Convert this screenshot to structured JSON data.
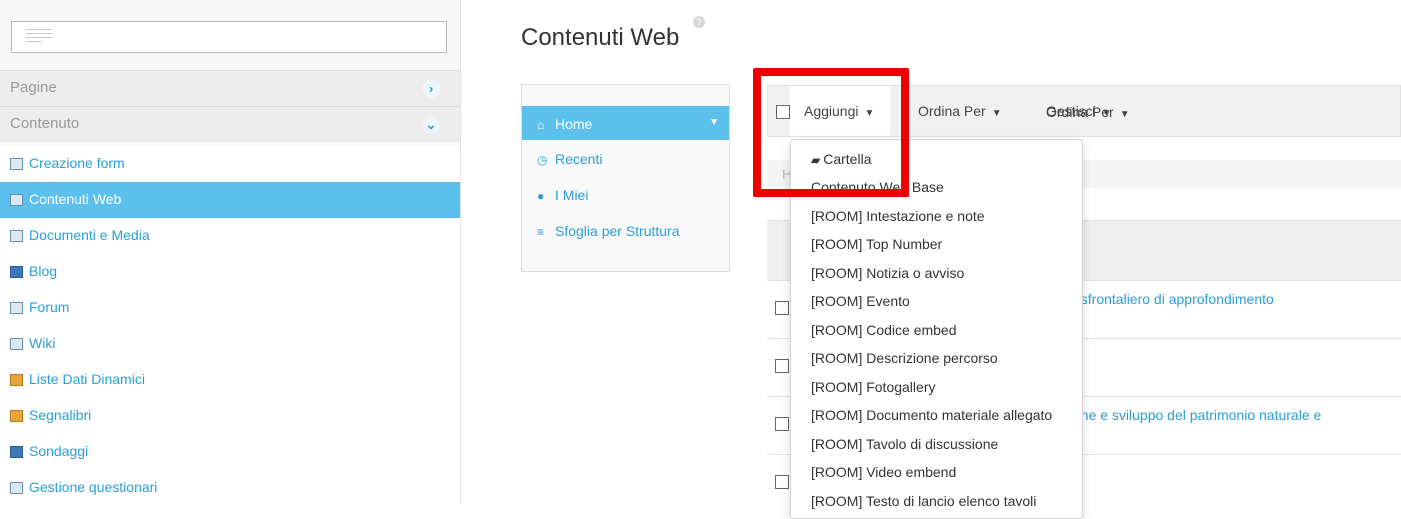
{
  "sidebar": {
    "panels": [
      {
        "label": "Pagine",
        "chevron": "›"
      },
      {
        "label": "Contenuto",
        "chevron": "⌄"
      }
    ],
    "items": [
      {
        "label": "Creazione form",
        "icon": "form-icon"
      },
      {
        "label": "Contenuti Web",
        "icon": "web-content-icon",
        "active": true
      },
      {
        "label": "Documenti e Media",
        "icon": "documents-icon"
      },
      {
        "label": "Blog",
        "icon": "blog-icon"
      },
      {
        "label": "Forum",
        "icon": "forum-icon"
      },
      {
        "label": "Wiki",
        "icon": "wiki-icon"
      },
      {
        "label": "Liste Dati Dinamici",
        "icon": "dynamic-lists-icon"
      },
      {
        "label": "Segnalibri",
        "icon": "bookmarks-icon"
      },
      {
        "label": "Sondaggi",
        "icon": "polls-icon"
      },
      {
        "label": "Gestione questionari",
        "icon": "questionnaire-icon"
      }
    ]
  },
  "main": {
    "title": "Contenuti Web",
    "help_glyph": "?",
    "nav": [
      {
        "label": "Home",
        "glyph": "⌂",
        "active": true
      },
      {
        "label": "Recenti",
        "glyph": "◷"
      },
      {
        "label": "I Miei",
        "glyph": "●"
      },
      {
        "label": "Sfoglia per Struttura",
        "glyph": "≡"
      }
    ],
    "toolbar": {
      "add_label": "Aggiungi",
      "order_label": "Ordina Per",
      "manage_label": "Gestisci",
      "caret": "▼"
    },
    "breadcrumb_start": "H",
    "rows": [
      {
        "text": "nsfrontaliero di approfondimento"
      },
      {
        "text": ""
      },
      {
        "text": "one e sviluppo del patrimonio naturale e"
      },
      {
        "text": ""
      }
    ]
  },
  "dropdown": {
    "items": [
      "Cartella",
      "Contenuto Web Base",
      "[ROOM] Intestazione e note",
      "[ROOM] Top Number",
      "[ROOM] Notizia o avviso",
      "[ROOM] Evento",
      "[ROOM] Codice embed",
      "[ROOM] Descrizione percorso",
      "[ROOM] Fotogallery",
      "[ROOM] Documento materiale allegato",
      "[ROOM] Tavolo di discussione",
      "[ROOM] Video embend",
      "[ROOM] Testo di lancio elenco tavoli"
    ]
  },
  "colors": {
    "accent": "#5bc0eb",
    "link": "#2a9fd6",
    "highlight": "#ee0000"
  }
}
